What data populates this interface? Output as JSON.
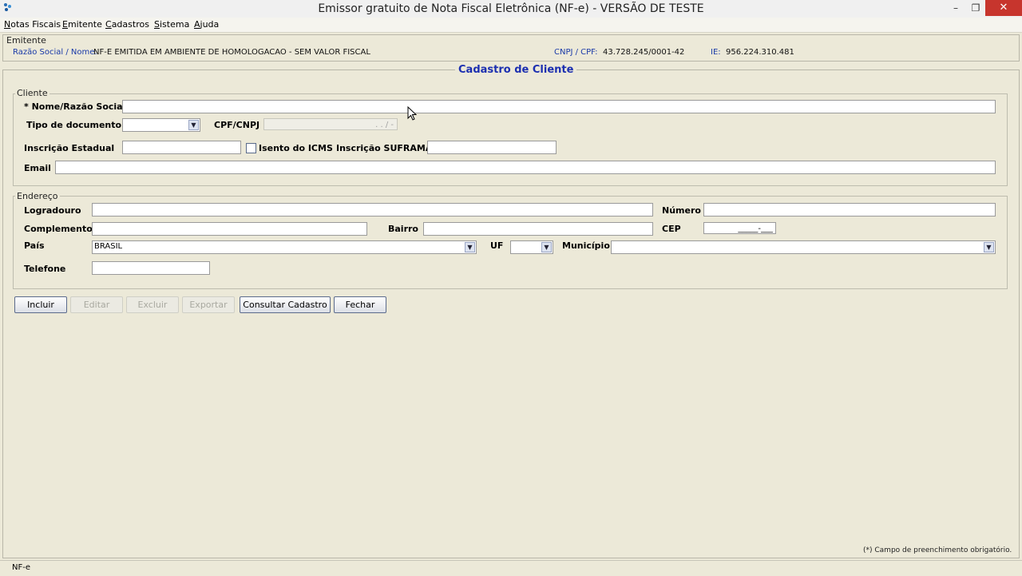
{
  "window": {
    "title": "Emissor gratuito de Nota Fiscal Eletrônica (NF-e) - VERSÃO DE TESTE",
    "minimize": "–",
    "restore": "❐",
    "close": "✕"
  },
  "menu": [
    "Notas Fiscais",
    "Emitente",
    "Cadastros",
    "Sistema",
    "Ajuda"
  ],
  "emitente": {
    "group_label": "Emitente",
    "razao_label": "Razão Social / Nome:",
    "razao_value": "NF-E EMITIDA EM AMBIENTE DE HOMOLOGACAO - SEM VALOR FISCAL",
    "cnpj_label": "CNPJ / CPF:",
    "cnpj_value": "43.728.245/0001-42",
    "ie_label": "IE:",
    "ie_value": "956.224.310.481"
  },
  "form": {
    "title": "Cadastro de Cliente",
    "cliente": {
      "group_label": "Cliente",
      "nome_label": "* Nome/Razão Social",
      "nome_value": "",
      "tipo_doc_label": "Tipo de documento",
      "tipo_doc_value": "",
      "cpf_label": "CPF/CNPJ",
      "cpf_mask": ".   .   /   -",
      "ie_label": "Inscrição Estadual",
      "isento_label": "Isento do ICMS",
      "suframa_label": "Inscrição SUFRAMA",
      "email_label": "Email"
    },
    "endereco": {
      "group_label": "Endereço",
      "logradouro_label": "Logradouro",
      "numero_label": "Número",
      "complemento_label": "Complemento",
      "bairro_label": "Bairro",
      "cep_label": "CEP",
      "cep_mask": "_____-___",
      "pais_label": "País",
      "pais_value": "BRASIL",
      "uf_label": "UF",
      "uf_value": "",
      "municipio_label": "Município",
      "municipio_value": "",
      "telefone_label": "Telefone"
    },
    "buttons": {
      "incluir": "Incluir",
      "editar": "Editar",
      "excluir": "Excluir",
      "exportar": "Exportar",
      "consultar": "Consultar Cadastro",
      "fechar": "Fechar"
    },
    "footnote": "(*) Campo de preenchimento obrigatório."
  },
  "status": {
    "text": "NF-e"
  }
}
